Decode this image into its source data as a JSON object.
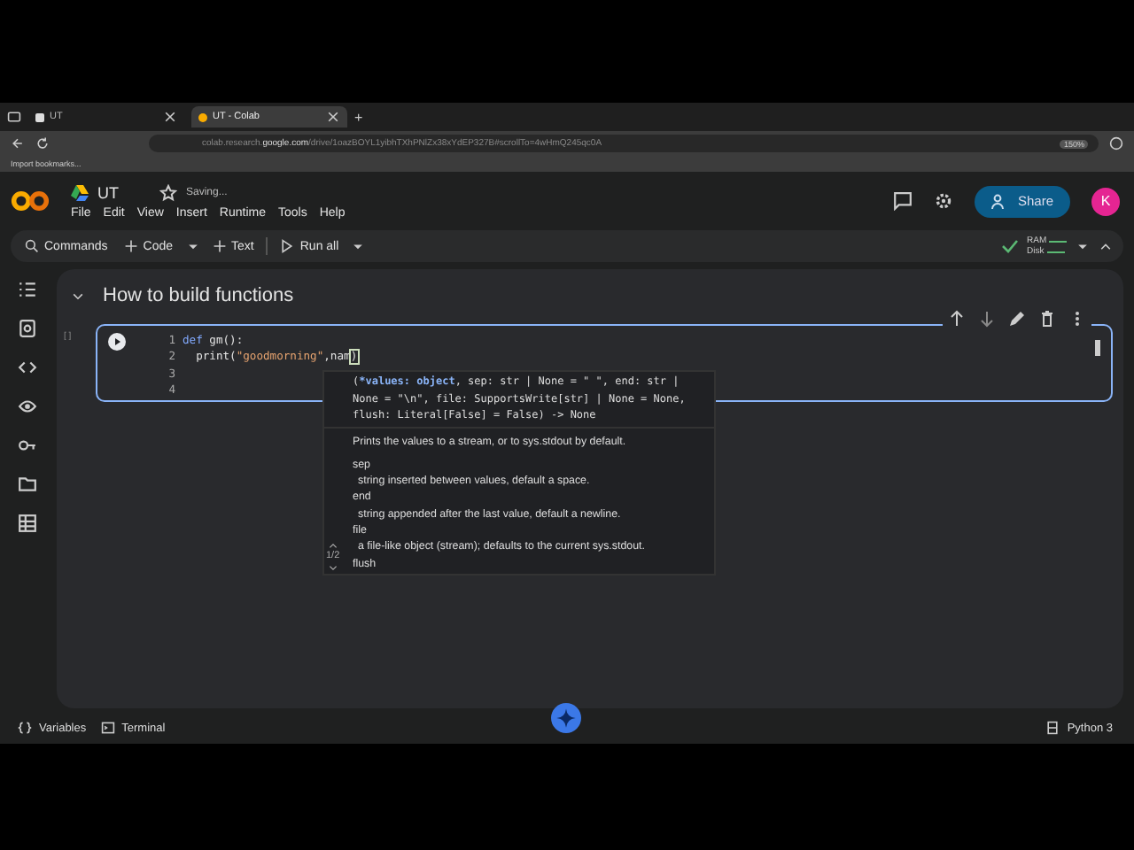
{
  "browser": {
    "tabs": [
      {
        "title": "UT",
        "selected": false
      },
      {
        "title": "UT - Colab",
        "selected": true
      }
    ],
    "new_tab": "+",
    "url_host": "colab.research.",
    "url_domain": "google.com",
    "url_path": "/drive/1oazBOYL1yibhTXhPNlZx38xYdEP327B#scrollTo=4wHmQ245qc0A",
    "zoom": "150%",
    "bookmarks": [
      "Import bookmarks..."
    ]
  },
  "header": {
    "title": "UT",
    "status": "Saving...",
    "menu": [
      "File",
      "Edit",
      "View",
      "Insert",
      "Runtime",
      "Tools",
      "Help"
    ],
    "share": "Share",
    "avatar": "K"
  },
  "toolbar": {
    "commands": "Commands",
    "code": "Code",
    "text": "Text",
    "run_all": "Run all",
    "ram": "RAM",
    "disk": "Disk"
  },
  "section": {
    "title": "How to build functions",
    "expanded": true
  },
  "cell": {
    "run_marker": "[ ]",
    "lines": [
      {
        "number": "1",
        "tokens": [
          {
            "kind": "keyword",
            "text": "def"
          },
          {
            "kind": "plain",
            "text": " gm():"
          }
        ]
      },
      {
        "number": "2",
        "tokens": [
          {
            "kind": "plain",
            "text": "  print("
          },
          {
            "kind": "string",
            "text": "\"goodmorning\""
          },
          {
            "kind": "plain",
            "text": ",nam"
          },
          {
            "kind": "bracket",
            "text": ")"
          }
        ]
      },
      {
        "number": "3"
      },
      {
        "number": "4"
      }
    ]
  },
  "tooltip": {
    "signature": [
      {
        "kind": "plain",
        "text": "("
      },
      {
        "kind": "param",
        "text": "*values: object"
      },
      {
        "kind": "plain",
        "text": ", sep: str | None = \" \", end: str | None = \"\\n\", file: SupportsWrite[str] | None = None, flush: Literal[False] = False) -> None"
      }
    ],
    "description": "Prints the values to a stream, or to sys.stdout by default.",
    "params": [
      {
        "name": "sep",
        "text": "string inserted between values, default a space."
      },
      {
        "name": "end",
        "text": "string appended after the last value, default a newline."
      },
      {
        "name": "file",
        "text": "a file-like object (stream); defaults to the current sys.stdout."
      },
      {
        "name": "flush"
      }
    ],
    "counter": "1/2"
  },
  "status_bar": {
    "variables": "Variables",
    "terminal": "Terminal",
    "runtime": "Python 3"
  }
}
